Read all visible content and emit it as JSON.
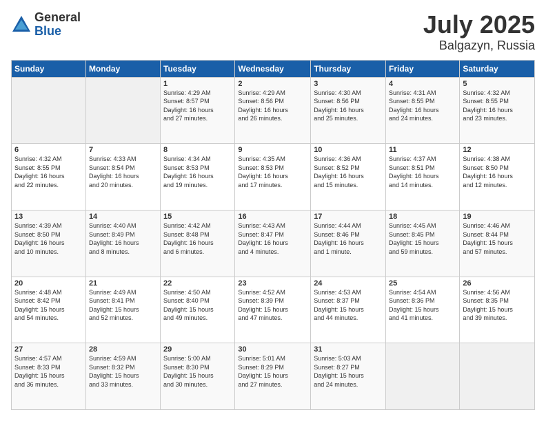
{
  "header": {
    "logo_general": "General",
    "logo_blue": "Blue",
    "month": "July 2025",
    "location": "Balgazyn, Russia"
  },
  "calendar": {
    "days_of_week": [
      "Sunday",
      "Monday",
      "Tuesday",
      "Wednesday",
      "Thursday",
      "Friday",
      "Saturday"
    ],
    "weeks": [
      [
        {
          "day": "",
          "info": ""
        },
        {
          "day": "",
          "info": ""
        },
        {
          "day": "1",
          "info": "Sunrise: 4:29 AM\nSunset: 8:57 PM\nDaylight: 16 hours\nand 27 minutes."
        },
        {
          "day": "2",
          "info": "Sunrise: 4:29 AM\nSunset: 8:56 PM\nDaylight: 16 hours\nand 26 minutes."
        },
        {
          "day": "3",
          "info": "Sunrise: 4:30 AM\nSunset: 8:56 PM\nDaylight: 16 hours\nand 25 minutes."
        },
        {
          "day": "4",
          "info": "Sunrise: 4:31 AM\nSunset: 8:55 PM\nDaylight: 16 hours\nand 24 minutes."
        },
        {
          "day": "5",
          "info": "Sunrise: 4:32 AM\nSunset: 8:55 PM\nDaylight: 16 hours\nand 23 minutes."
        }
      ],
      [
        {
          "day": "6",
          "info": "Sunrise: 4:32 AM\nSunset: 8:55 PM\nDaylight: 16 hours\nand 22 minutes."
        },
        {
          "day": "7",
          "info": "Sunrise: 4:33 AM\nSunset: 8:54 PM\nDaylight: 16 hours\nand 20 minutes."
        },
        {
          "day": "8",
          "info": "Sunrise: 4:34 AM\nSunset: 8:53 PM\nDaylight: 16 hours\nand 19 minutes."
        },
        {
          "day": "9",
          "info": "Sunrise: 4:35 AM\nSunset: 8:53 PM\nDaylight: 16 hours\nand 17 minutes."
        },
        {
          "day": "10",
          "info": "Sunrise: 4:36 AM\nSunset: 8:52 PM\nDaylight: 16 hours\nand 15 minutes."
        },
        {
          "day": "11",
          "info": "Sunrise: 4:37 AM\nSunset: 8:51 PM\nDaylight: 16 hours\nand 14 minutes."
        },
        {
          "day": "12",
          "info": "Sunrise: 4:38 AM\nSunset: 8:50 PM\nDaylight: 16 hours\nand 12 minutes."
        }
      ],
      [
        {
          "day": "13",
          "info": "Sunrise: 4:39 AM\nSunset: 8:50 PM\nDaylight: 16 hours\nand 10 minutes."
        },
        {
          "day": "14",
          "info": "Sunrise: 4:40 AM\nSunset: 8:49 PM\nDaylight: 16 hours\nand 8 minutes."
        },
        {
          "day": "15",
          "info": "Sunrise: 4:42 AM\nSunset: 8:48 PM\nDaylight: 16 hours\nand 6 minutes."
        },
        {
          "day": "16",
          "info": "Sunrise: 4:43 AM\nSunset: 8:47 PM\nDaylight: 16 hours\nand 4 minutes."
        },
        {
          "day": "17",
          "info": "Sunrise: 4:44 AM\nSunset: 8:46 PM\nDaylight: 16 hours\nand 1 minute."
        },
        {
          "day": "18",
          "info": "Sunrise: 4:45 AM\nSunset: 8:45 PM\nDaylight: 15 hours\nand 59 minutes."
        },
        {
          "day": "19",
          "info": "Sunrise: 4:46 AM\nSunset: 8:44 PM\nDaylight: 15 hours\nand 57 minutes."
        }
      ],
      [
        {
          "day": "20",
          "info": "Sunrise: 4:48 AM\nSunset: 8:42 PM\nDaylight: 15 hours\nand 54 minutes."
        },
        {
          "day": "21",
          "info": "Sunrise: 4:49 AM\nSunset: 8:41 PM\nDaylight: 15 hours\nand 52 minutes."
        },
        {
          "day": "22",
          "info": "Sunrise: 4:50 AM\nSunset: 8:40 PM\nDaylight: 15 hours\nand 49 minutes."
        },
        {
          "day": "23",
          "info": "Sunrise: 4:52 AM\nSunset: 8:39 PM\nDaylight: 15 hours\nand 47 minutes."
        },
        {
          "day": "24",
          "info": "Sunrise: 4:53 AM\nSunset: 8:37 PM\nDaylight: 15 hours\nand 44 minutes."
        },
        {
          "day": "25",
          "info": "Sunrise: 4:54 AM\nSunset: 8:36 PM\nDaylight: 15 hours\nand 41 minutes."
        },
        {
          "day": "26",
          "info": "Sunrise: 4:56 AM\nSunset: 8:35 PM\nDaylight: 15 hours\nand 39 minutes."
        }
      ],
      [
        {
          "day": "27",
          "info": "Sunrise: 4:57 AM\nSunset: 8:33 PM\nDaylight: 15 hours\nand 36 minutes."
        },
        {
          "day": "28",
          "info": "Sunrise: 4:59 AM\nSunset: 8:32 PM\nDaylight: 15 hours\nand 33 minutes."
        },
        {
          "day": "29",
          "info": "Sunrise: 5:00 AM\nSunset: 8:30 PM\nDaylight: 15 hours\nand 30 minutes."
        },
        {
          "day": "30",
          "info": "Sunrise: 5:01 AM\nSunset: 8:29 PM\nDaylight: 15 hours\nand 27 minutes."
        },
        {
          "day": "31",
          "info": "Sunrise: 5:03 AM\nSunset: 8:27 PM\nDaylight: 15 hours\nand 24 minutes."
        },
        {
          "day": "",
          "info": ""
        },
        {
          "day": "",
          "info": ""
        }
      ]
    ]
  }
}
